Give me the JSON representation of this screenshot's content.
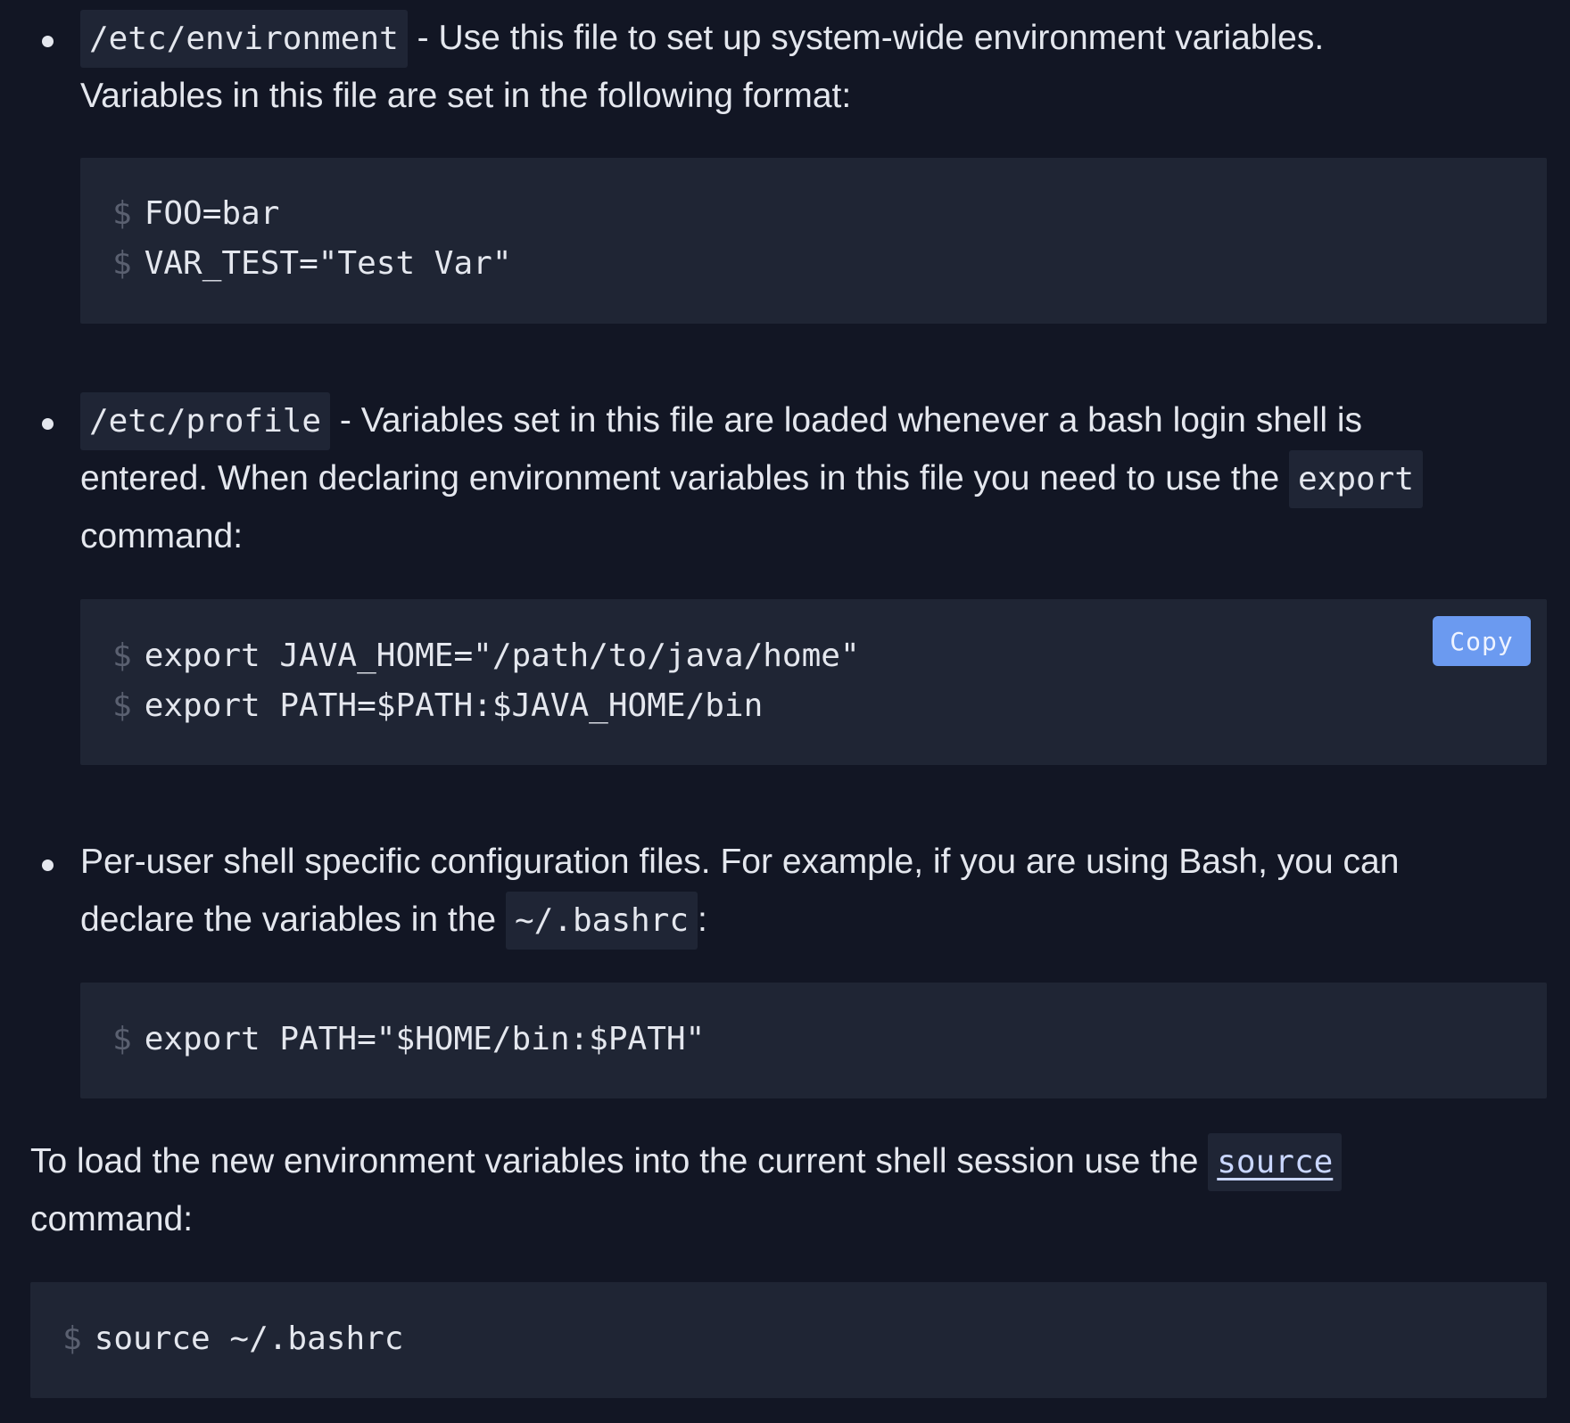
{
  "colors": {
    "background": "#121624",
    "code_background": "#1f2534",
    "copy_button": "#6b9af0",
    "text": "#e4e7ee"
  },
  "prompt_symbol": "$",
  "items": [
    {
      "code": "/etc/environment",
      "text_line1": " - Use this file to set up system-wide environment variables.",
      "text_line2": "Variables in this file are set in the following format:",
      "block": [
        "FOO=bar",
        "VAR_TEST=\"Test Var\""
      ]
    },
    {
      "code": "/etc/profile",
      "text_line1": " - Variables set in this file are loaded whenever a bash login shell is",
      "text_line2": "entered. When declaring environment variables in this file you need to use the ",
      "code2": "export",
      "text_line3": "command:",
      "block": [
        "export JAVA_HOME=\"/path/to/java/home\"",
        "export PATH=$PATH:$JAVA_HOME/bin"
      ],
      "copy_label": "Copy"
    },
    {
      "text_line1": "Per-user shell specific configuration files. For example, if you are using Bash, you can",
      "text_line2": "declare the variables in the ",
      "code": "~/.bashrc",
      "text_line2_end": ":",
      "block": [
        "export PATH=\"$HOME/bin:$PATH\""
      ]
    }
  ],
  "closing": {
    "text_line1": "To load the new environment variables into the current shell session use the ",
    "link_code": "source",
    "text_line2": "command:",
    "block": [
      "source ~/.bashrc"
    ]
  }
}
